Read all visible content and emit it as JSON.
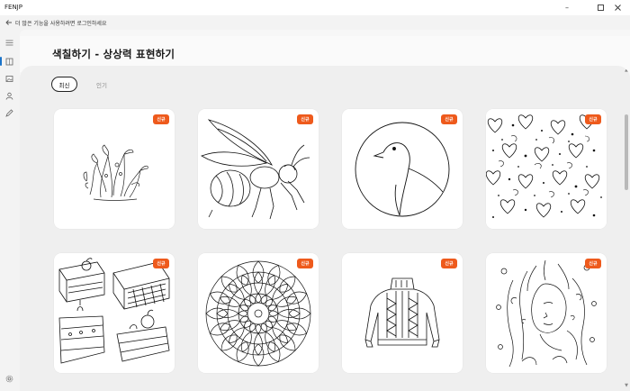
{
  "window": {
    "title": "FENJP",
    "controls": {
      "minimize": "–",
      "maximize": "☐",
      "close": "✕"
    }
  },
  "subbar": {
    "back_icon": "arrow-left-icon",
    "notice": "더 많은 기능을 사용하려면 로그인하세요"
  },
  "sidebar": {
    "items": [
      {
        "name": "menu",
        "icon": "hamburger-icon",
        "active": false
      },
      {
        "name": "library",
        "icon": "book-icon",
        "active": true
      },
      {
        "name": "gallery",
        "icon": "image-icon",
        "active": false
      },
      {
        "name": "profile",
        "icon": "user-icon",
        "active": false
      },
      {
        "name": "draw",
        "icon": "brush-icon",
        "active": false
      }
    ],
    "settings_icon": "gear-icon",
    "accent": "#1a73c9"
  },
  "page": {
    "title": "색칠하기 - 상상력 표현하기"
  },
  "tabs": [
    {
      "label": "최신",
      "selected": true
    },
    {
      "label": "인기",
      "selected": false
    }
  ],
  "badge_color": "#ee5a1c",
  "cards": [
    {
      "subject": "coral-plants",
      "badge": "신규"
    },
    {
      "subject": "wasp",
      "badge": "신규"
    },
    {
      "subject": "bird-in-circle",
      "badge": "신규"
    },
    {
      "subject": "hearts-pattern",
      "badge": "신규"
    },
    {
      "subject": "cakes",
      "badge": "신규"
    },
    {
      "subject": "mandala",
      "badge": "신규"
    },
    {
      "subject": "sweater",
      "badge": "신규"
    },
    {
      "subject": "ornate-woman",
      "badge": "신규"
    }
  ]
}
